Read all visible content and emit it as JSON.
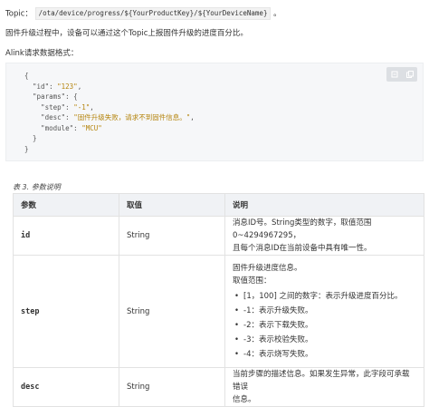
{
  "topic": {
    "label": "Topic：",
    "path": "/ota/device/progress/${YourProductKey}/${YourDeviceName}",
    "end": "。"
  },
  "description": "固件升级过程中，设备可以通过这个Topic上报固件升级的进度百分比。",
  "format_label": "Alink请求数据格式：",
  "code": {
    "actions": [
      "code-collapse-icon",
      "copy-icon"
    ],
    "lines": [
      {
        "t": "{",
        "s": null,
        "e": ""
      },
      {
        "t": "  \"id\": ",
        "s": "\"123\"",
        "e": ","
      },
      {
        "t": "  \"params\": {",
        "s": null,
        "e": ""
      },
      {
        "t": "    \"step\": ",
        "s": "\"-1\"",
        "e": ","
      },
      {
        "t": "    \"desc\": ",
        "s": "\"固件升级失败，请求不到固件信息。\"",
        "e": ","
      },
      {
        "t": "    \"module\": ",
        "s": "\"MCU\"",
        "e": ""
      },
      {
        "t": "  }",
        "s": null,
        "e": ""
      },
      {
        "t": "}",
        "s": null,
        "e": ""
      }
    ]
  },
  "table": {
    "caption": "表 3. 参数说明",
    "headers": [
      "参数",
      "取值",
      "说明"
    ],
    "rows": [
      {
        "param": "id",
        "value": "String",
        "desc": [
          "消息ID号。String类型的数字，取值范围0~4294967295，",
          "且每个消息ID在当前设备中具有唯一性。"
        ],
        "bullets": []
      },
      {
        "param": "step",
        "value": "String",
        "desc": [
          "固件升级进度信息。",
          "取值范围："
        ],
        "bullets": [
          "[1，100] 之间的数字：表示升级进度百分比。",
          "-1：表示升级失败。",
          "-2：表示下载失败。",
          "-3：表示校验失败。",
          "-4：表示烧写失败。"
        ]
      },
      {
        "param": "desc",
        "value": "String",
        "desc": [
          "当前步骤的描述信息。如果发生异常，此字段可承载错误",
          "信息。"
        ],
        "bullets": []
      }
    ]
  }
}
